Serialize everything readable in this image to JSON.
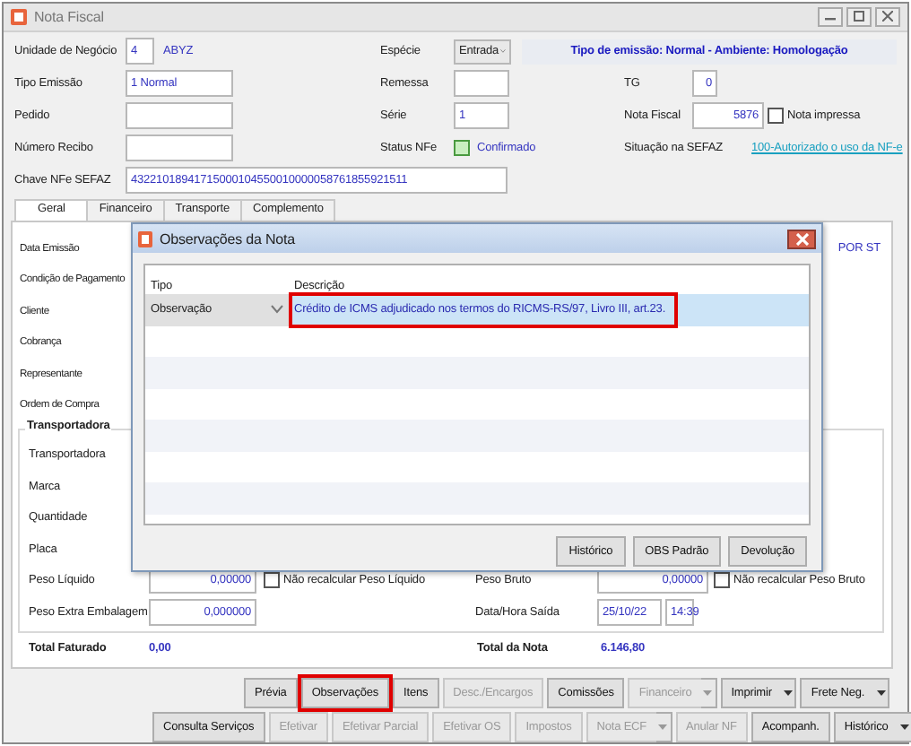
{
  "window": {
    "title": "Nota Fiscal"
  },
  "header": {
    "unidade_negocio": {
      "label": "Unidade de Negócio",
      "value": "4",
      "description": "ABYZ"
    },
    "especie": {
      "label": "Espécie",
      "value": "Entrada"
    },
    "banner": "Tipo de emissão: Normal - Ambiente: Homologação",
    "tipo_emissao": {
      "label": "Tipo Emissão",
      "value": "1 Normal"
    },
    "remessa": {
      "label": "Remessa"
    },
    "tg": {
      "label": "TG",
      "value": "0"
    },
    "pedido": {
      "label": "Pedido"
    },
    "serie": {
      "label": "Série",
      "value": "1"
    },
    "nota_fiscal": {
      "label": "Nota Fiscal",
      "value": "5876"
    },
    "nota_impressa": {
      "label": "Nota impressa",
      "checked": false
    },
    "numero_recibo": {
      "label": "Número Recibo"
    },
    "status_nfe": {
      "label": "Status NFe",
      "value": "Confirmado"
    },
    "situacao_sefaz": {
      "label": "Situação na SEFAZ",
      "link": "100-Autorizado o uso da NF-e"
    },
    "chave_nfe": {
      "label": "Chave NFe SEFAZ",
      "value": "43221018941715000104550010000058761855921511"
    }
  },
  "tabs": [
    {
      "label": "Geral",
      "selected": true
    },
    {
      "label": "Financeiro",
      "selected": false
    },
    {
      "label": "Transporte",
      "selected": false
    },
    {
      "label": "Complemento",
      "selected": false
    }
  ],
  "panel": {
    "labels": [
      "Data Emissão",
      "Condição de Pagamento",
      "Cliente",
      "Cobrança",
      "Representante",
      "Ordem de Compra"
    ],
    "side_note": "POR ST",
    "transport_group": {
      "title": "Transportadora",
      "labels": [
        "Transportadora",
        "Marca",
        "Quantidade",
        "Placa"
      ],
      "peso_liquido": {
        "label": "Peso Líquido",
        "value": "0,00000",
        "recalc": {
          "label": "Não recalcular Peso Líquido",
          "checked": false
        }
      },
      "peso_bruto": {
        "label": "Peso Bruto",
        "value": "0,00000",
        "recalc": {
          "label": "Não recalcular Peso Bruto",
          "checked": false
        }
      },
      "peso_extra": {
        "label": "Peso Extra Embalagem",
        "value": "0,000000"
      },
      "data_hora_saida": {
        "label": "Data/Hora Saída",
        "date": "25/10/22",
        "time": "14:39"
      }
    },
    "totals": [
      {
        "label": "Total Faturado",
        "value": "0,00"
      },
      {
        "label": "Total da Nota",
        "value": "6.146,80"
      }
    ]
  },
  "buttons": [
    [
      {
        "label": "Prévia",
        "disabled": false,
        "has_menu": false,
        "highlighted": false
      },
      {
        "label": "Observações",
        "disabled": false,
        "has_menu": false,
        "highlighted": true
      },
      {
        "label": "Itens",
        "disabled": false,
        "has_menu": false,
        "highlighted": false
      },
      {
        "label": "Desc./Encargos",
        "disabled": true,
        "has_menu": false,
        "highlighted": false
      },
      {
        "label": "Comissões",
        "disabled": false,
        "has_menu": false,
        "highlighted": false
      },
      {
        "label": "Financeiro",
        "disabled": true,
        "has_menu": true,
        "highlighted": false
      },
      {
        "label": "Imprimir",
        "disabled": false,
        "has_menu": true,
        "highlighted": false
      },
      {
        "label": "Frete Neg.",
        "disabled": false,
        "has_menu": true,
        "highlighted": false
      }
    ],
    [
      {
        "label": "Consulta Serviços",
        "disabled": false,
        "has_menu": false,
        "highlighted": false
      },
      {
        "label": "Efetivar",
        "disabled": true,
        "has_menu": false,
        "highlighted": false
      },
      {
        "label": "Efetivar Parcial",
        "disabled": true,
        "has_menu": false,
        "highlighted": false
      },
      {
        "label": "Efetivar OS",
        "disabled": true,
        "has_menu": false,
        "highlighted": false
      },
      {
        "label": "Impostos",
        "disabled": true,
        "has_menu": false,
        "highlighted": false
      },
      {
        "label": "Nota ECF",
        "disabled": true,
        "has_menu": true,
        "highlighted": false
      },
      {
        "label": "Anular NF",
        "disabled": true,
        "has_menu": false,
        "highlighted": false
      },
      {
        "label": "Acompanh.",
        "disabled": false,
        "has_menu": false,
        "highlighted": false
      },
      {
        "label": "Histórico",
        "disabled": false,
        "has_menu": true,
        "highlighted": false
      }
    ]
  ],
  "dialog": {
    "title": "Observações da Nota",
    "columns": [
      "Tipo",
      "Descrição"
    ],
    "rows": [
      {
        "tipo": "Observação",
        "descricao": "Crédito de ICMS adjudicado nos termos do RICMS-RS/97, Livro III, art.23.",
        "selected": true,
        "highlighted": true
      }
    ],
    "buttons": [
      "Histórico",
      "OBS Padrão",
      "Devolução"
    ]
  }
}
